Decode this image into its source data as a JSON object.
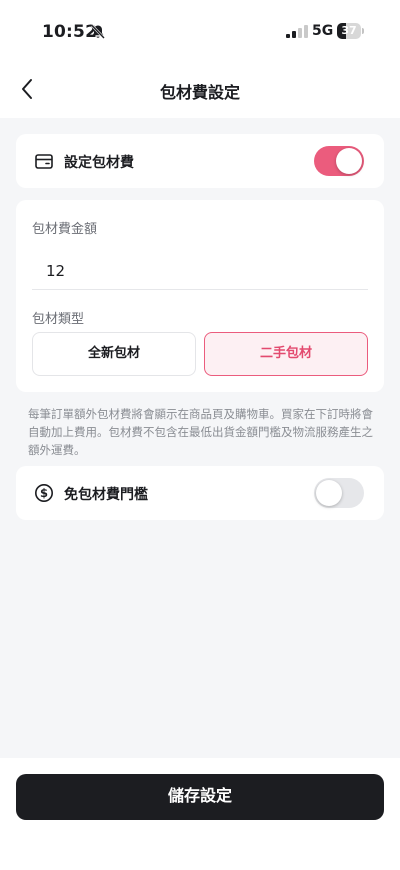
{
  "status_bar": {
    "time": "10:52",
    "network": "5G",
    "battery_level": "37"
  },
  "header": {
    "title": "包材費設定"
  },
  "packaging_fee_toggle": {
    "label": "設定包材費",
    "enabled": true
  },
  "fee_amount": {
    "label": "包材費金額",
    "value": "12"
  },
  "packaging_type": {
    "label": "包材類型",
    "options": [
      "全新包材",
      "二手包材"
    ],
    "selected": "二手包材"
  },
  "help_text": "每筆訂單額外包材費將會顯示在商品頁及購物車。買家在下訂時將會自動加上費用。包材費不包含在最低出貨金額門檻及物流服務產生之額外運費。",
  "free_threshold_toggle": {
    "label": "免包材費門檻",
    "enabled": false
  },
  "save_label": "儲存設定",
  "colors": {
    "accent": "#eb5c7d",
    "background": "#f5f6f8",
    "primary_button": "#1c1d21"
  }
}
